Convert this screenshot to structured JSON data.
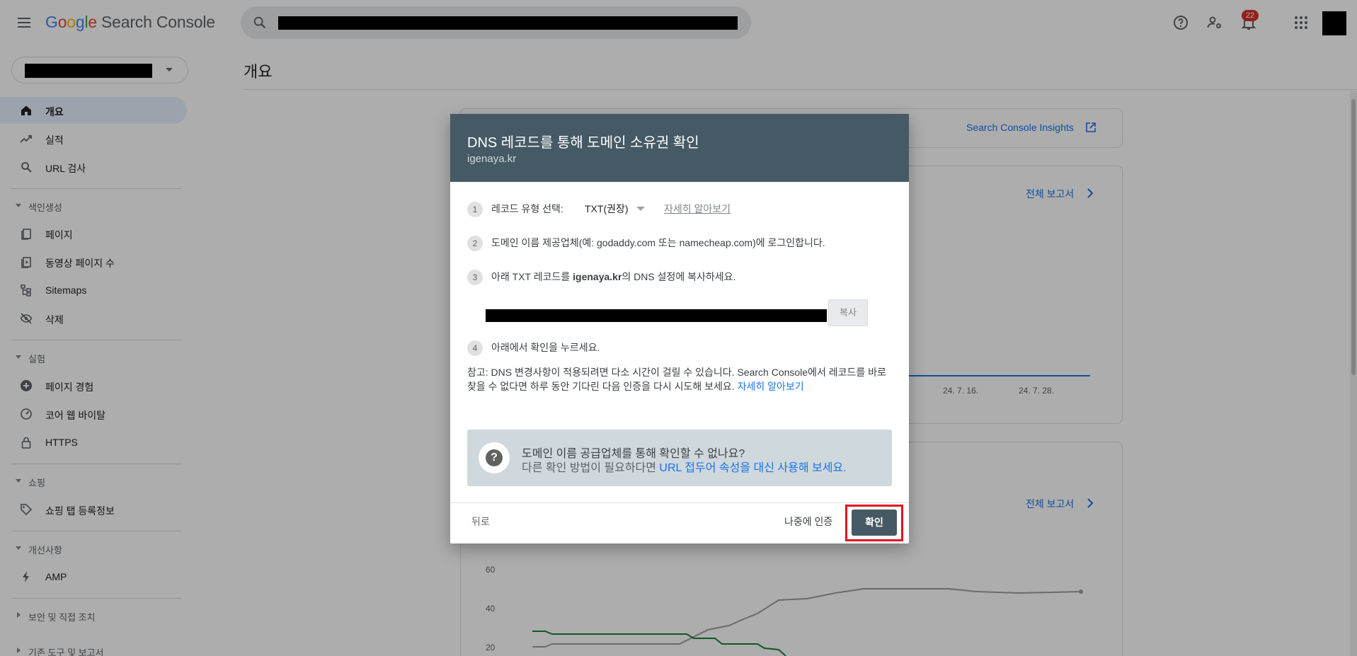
{
  "header": {
    "product_name": "Search Console",
    "logo_letters": [
      "G",
      "o",
      "o",
      "g",
      "l",
      "e"
    ],
    "search_placeholder": "",
    "notification_count": "22",
    "icons": [
      "menu-icon",
      "search-icon",
      "help-icon",
      "manage-users-icon",
      "notifications-icon",
      "apps-icon"
    ]
  },
  "sidebar": {
    "items": [
      {
        "label": "개요",
        "icon": "home-icon",
        "active": true
      },
      {
        "label": "실적",
        "icon": "trending-icon"
      },
      {
        "label": "URL 검사",
        "icon": "search-icon"
      }
    ],
    "sections": [
      {
        "label": "색인생성",
        "items": [
          {
            "label": "페이지",
            "icon": "pages-icon"
          },
          {
            "label": "동영상 페이지 수",
            "icon": "video-pages-icon"
          },
          {
            "label": "Sitemaps",
            "icon": "sitemaps-icon"
          },
          {
            "label": "삭제",
            "icon": "removals-icon"
          }
        ]
      },
      {
        "label": "실험",
        "items": [
          {
            "label": "페이지 경험",
            "icon": "add-circle-icon"
          },
          {
            "label": "코어 웹 바이탈",
            "icon": "gauge-icon"
          },
          {
            "label": "HTTPS",
            "icon": "lock-icon"
          }
        ]
      },
      {
        "label": "쇼핑",
        "items": [
          {
            "label": "쇼핑 탭 등록정보",
            "icon": "tag-icon"
          }
        ]
      },
      {
        "label": "개선사항",
        "items": [
          {
            "label": "AMP",
            "icon": "bolt-icon"
          }
        ]
      },
      {
        "label": "보안 및 직접 조치"
      },
      {
        "label": "기존 도구 및 보고서"
      }
    ]
  },
  "main": {
    "title": "개요",
    "insights_link": "Search Console Insights",
    "full_report_1": "전체 보고서",
    "full_report_2": "전체 보고서",
    "chart_ticks_x": [
      "24. 7. 16.",
      "24. 7. 28."
    ],
    "chart_ticks_y": [
      "60",
      "40",
      "20"
    ]
  },
  "dialog": {
    "title": "DNS 레코드를 통해 도메인 소유권 확인",
    "subtitle": "igenaya.kr",
    "steps": [
      {
        "num": "1",
        "text": "레코드 유형 선택:"
      },
      {
        "num": "2",
        "text": "도메인 이름 제공업체(예: godaddy.com 또는 namecheap.com)에 로그인합니다."
      },
      {
        "num": "3",
        "text_before": "아래 TXT 레코드를 ",
        "domain": "igenaya.kr",
        "text_after": "의 DNS 설정에 복사하세요."
      },
      {
        "num": "4",
        "text": "아래에서 확인을 누르세요."
      }
    ],
    "record_type": "TXT(권장)",
    "learn_more": "자세히 알아보기",
    "copy_label": "복사",
    "note": "참고: DNS 변경사항이 적용되려면 다소 시간이 걸릴 수 있습니다. Search Console에서 레코드를 바로 찾을 수 없다면 하루 동안 기다린 다음 인증을 다시 시도해 보세요. ",
    "note_link": "자세히 알아보기",
    "help_title": "도메인 이름 공급업체를 통해 확인할 수 없나요?",
    "help_desc": "다른 확인 방법이 필요하다면 ",
    "help_link": "URL 접두어 속성을 대신 사용해 보세요.",
    "back_label": "뒤로",
    "later_label": "나중에 인증",
    "confirm_label": "확인"
  },
  "colors": {
    "dialog_header": "#455a64",
    "help_box": "#cfd8dc",
    "confirm_button": "#455a64",
    "highlight_frame": "#e8101f",
    "link": "#1a73e8"
  }
}
